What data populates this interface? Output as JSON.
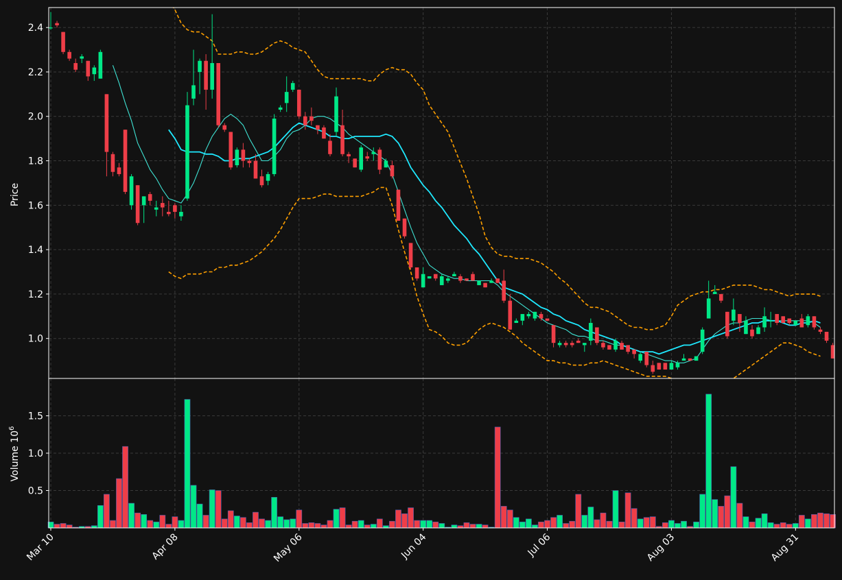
{
  "chart_data": {
    "type": "candlestick",
    "theme": {
      "background": "#121212",
      "grid": "#3a3a3a",
      "up": "#00e887",
      "down": "#ee3e48",
      "ma_fast": "#3fe3d4",
      "ma_slow": "#1fe9ff",
      "bands": "#ffa000",
      "axis": "#ffffff"
    },
    "price_panel": {
      "ylabel": "Price",
      "ylim": [
        0.82,
        2.49
      ],
      "yticks": [
        1.0,
        1.2,
        1.4,
        1.6,
        1.8,
        2.0,
        2.2,
        2.4
      ],
      "ytick_labels": [
        "1.0",
        "1.2",
        "1.4",
        "1.6",
        "1.8",
        "2.0",
        "2.2",
        "2.4"
      ]
    },
    "volume_panel": {
      "ylabel": "Volume",
      "ylabel_suffix": "10",
      "ylabel_exp": "6",
      "ylim": [
        0,
        2.0
      ],
      "yticks": [
        0.5,
        1.0,
        1.5
      ],
      "ytick_labels": [
        "0.5",
        "1.0",
        "1.5"
      ]
    },
    "x_ticks": [
      {
        "index": 0,
        "label": "Mar 10"
      },
      {
        "index": 20,
        "label": "Apr 08"
      },
      {
        "index": 40,
        "label": "May 06"
      },
      {
        "index": 60,
        "label": "Jun 04"
      },
      {
        "index": 80,
        "label": "Jul 06"
      },
      {
        "index": 100,
        "label": "Aug 03"
      },
      {
        "index": 120,
        "label": "Aug 31"
      }
    ],
    "candles": [
      [
        2.4,
        2.47,
        2.39,
        2.4,
        0.08
      ],
      [
        2.42,
        2.43,
        2.4,
        2.41,
        0.05
      ],
      [
        2.38,
        2.38,
        2.28,
        2.29,
        0.06
      ],
      [
        2.29,
        2.3,
        2.25,
        2.26,
        0.04
      ],
      [
        2.24,
        2.26,
        2.2,
        2.21,
        0.01
      ],
      [
        2.26,
        2.28,
        2.24,
        2.27,
        0.02
      ],
      [
        2.25,
        2.25,
        2.16,
        2.18,
        0.02
      ],
      [
        2.19,
        2.23,
        2.16,
        2.22,
        0.03
      ],
      [
        2.17,
        2.3,
        2.17,
        2.29,
        0.3
      ],
      [
        2.1,
        2.1,
        1.73,
        1.84,
        0.45
      ],
      [
        1.83,
        1.84,
        1.73,
        1.75,
        0.1
      ],
      [
        1.77,
        1.79,
        1.73,
        1.74,
        0.66
      ],
      [
        1.94,
        1.94,
        1.65,
        1.66,
        1.09
      ],
      [
        1.6,
        1.74,
        1.58,
        1.73,
        0.33
      ],
      [
        1.69,
        1.69,
        1.51,
        1.52,
        0.2
      ],
      [
        1.6,
        1.64,
        1.52,
        1.64,
        0.18
      ],
      [
        1.65,
        1.66,
        1.6,
        1.62,
        0.1
      ],
      [
        1.58,
        1.62,
        1.55,
        1.59,
        0.08
      ],
      [
        1.61,
        1.64,
        1.55,
        1.59,
        0.17
      ],
      [
        1.57,
        1.62,
        1.55,
        1.56,
        0.05
      ],
      [
        1.6,
        1.61,
        1.54,
        1.57,
        0.15
      ],
      [
        1.55,
        1.6,
        1.53,
        1.57,
        0.1
      ],
      [
        1.63,
        2.11,
        1.62,
        2.05,
        1.72
      ],
      [
        2.08,
        2.3,
        2.05,
        2.14,
        0.57
      ],
      [
        2.2,
        2.26,
        2.1,
        2.25,
        0.32
      ],
      [
        2.25,
        2.28,
        2.03,
        2.12,
        0.17
      ],
      [
        2.12,
        2.46,
        2.08,
        2.24,
        0.51
      ],
      [
        2.24,
        2.24,
        1.95,
        1.96,
        0.5
      ],
      [
        1.96,
        1.97,
        1.93,
        1.94,
        0.12
      ],
      [
        1.93,
        1.93,
        1.76,
        1.77,
        0.23
      ],
      [
        1.78,
        1.86,
        1.77,
        1.85,
        0.16
      ],
      [
        1.85,
        1.88,
        1.77,
        1.8,
        0.14
      ],
      [
        1.8,
        1.81,
        1.77,
        1.79,
        0.07
      ],
      [
        1.8,
        1.83,
        1.72,
        1.72,
        0.21
      ],
      [
        1.73,
        1.76,
        1.68,
        1.69,
        0.12
      ],
      [
        1.71,
        1.75,
        1.69,
        1.74,
        0.1
      ],
      [
        1.74,
        2.01,
        1.73,
        1.99,
        0.41
      ],
      [
        2.03,
        2.05,
        2.02,
        2.04,
        0.15
      ],
      [
        2.06,
        2.18,
        2.02,
        2.11,
        0.11
      ],
      [
        2.12,
        2.16,
        2.11,
        2.15,
        0.12
      ],
      [
        2.12,
        2.12,
        1.99,
        2.0,
        0.24
      ],
      [
        2.0,
        2.02,
        1.94,
        1.96,
        0.06
      ],
      [
        2.0,
        2.04,
        1.96,
        1.98,
        0.07
      ],
      [
        1.96,
        1.96,
        1.92,
        1.94,
        0.06
      ],
      [
        1.95,
        1.96,
        1.9,
        1.9,
        0.04
      ],
      [
        1.89,
        1.92,
        1.82,
        1.83,
        0.1
      ],
      [
        1.93,
        2.13,
        1.91,
        2.09,
        0.25
      ],
      [
        1.96,
        2.03,
        1.82,
        1.83,
        0.27
      ],
      [
        1.83,
        1.84,
        1.79,
        1.82,
        0.04
      ],
      [
        1.81,
        1.81,
        1.77,
        1.77,
        0.09
      ],
      [
        1.76,
        1.87,
        1.75,
        1.86,
        0.1
      ],
      [
        1.82,
        1.84,
        1.8,
        1.81,
        0.04
      ],
      [
        1.83,
        1.86,
        1.8,
        1.84,
        0.05
      ],
      [
        1.85,
        1.86,
        1.74,
        1.76,
        0.12
      ],
      [
        1.77,
        1.81,
        1.77,
        1.8,
        0.03
      ],
      [
        1.78,
        1.8,
        1.72,
        1.73,
        0.09
      ],
      [
        1.67,
        1.67,
        1.53,
        1.53,
        0.24
      ],
      [
        1.54,
        1.54,
        1.45,
        1.46,
        0.19
      ],
      [
        1.43,
        1.43,
        1.31,
        1.32,
        0.27
      ],
      [
        1.32,
        1.32,
        1.26,
        1.27,
        0.1
      ],
      [
        1.23,
        1.32,
        1.23,
        1.29,
        0.1
      ],
      [
        1.27,
        1.28,
        1.27,
        1.28,
        0.1
      ],
      [
        1.29,
        1.29,
        1.26,
        1.27,
        0.08
      ],
      [
        1.24,
        1.29,
        1.24,
        1.28,
        0.06
      ],
      [
        1.26,
        1.28,
        1.25,
        1.27,
        0.01
      ],
      [
        1.28,
        1.3,
        1.28,
        1.29,
        0.04
      ],
      [
        1.28,
        1.29,
        1.25,
        1.26,
        0.03
      ],
      [
        1.27,
        1.27,
        1.26,
        1.26,
        0.07
      ],
      [
        1.29,
        1.3,
        1.26,
        1.26,
        0.05
      ],
      [
        1.24,
        1.26,
        1.24,
        1.26,
        0.05
      ],
      [
        1.25,
        1.25,
        1.23,
        1.23,
        0.04
      ],
      [
        1.25,
        1.27,
        1.25,
        1.26,
        0.01
      ],
      [
        1.27,
        1.27,
        1.25,
        1.25,
        1.35
      ],
      [
        1.26,
        1.31,
        1.16,
        1.17,
        0.29
      ],
      [
        1.17,
        1.2,
        1.04,
        1.04,
        0.24
      ],
      [
        1.07,
        1.09,
        1.07,
        1.08,
        0.14
      ],
      [
        1.08,
        1.11,
        1.06,
        1.11,
        0.08
      ],
      [
        1.1,
        1.12,
        1.09,
        1.11,
        0.12
      ],
      [
        1.09,
        1.12,
        1.08,
        1.12,
        0.04
      ],
      [
        1.11,
        1.12,
        1.08,
        1.09,
        0.08
      ],
      [
        1.09,
        1.09,
        1.08,
        1.08,
        0.1
      ],
      [
        1.06,
        1.06,
        0.96,
        0.98,
        0.14
      ],
      [
        0.97,
        0.99,
        0.96,
        0.98,
        0.17
      ],
      [
        0.98,
        0.99,
        0.96,
        0.97,
        0.06
      ],
      [
        0.98,
        0.99,
        0.96,
        0.97,
        0.09
      ],
      [
        0.99,
        1.0,
        0.98,
        0.98,
        0.45
      ],
      [
        0.97,
        0.98,
        0.94,
        0.98,
        0.17
      ],
      [
        0.99,
        1.09,
        0.97,
        1.07,
        0.28
      ],
      [
        1.05,
        1.05,
        0.97,
        0.98,
        0.11
      ],
      [
        0.98,
        0.99,
        0.95,
        0.96,
        0.2
      ],
      [
        0.97,
        0.97,
        0.95,
        0.95,
        0.09
      ],
      [
        0.95,
        1.0,
        0.94,
        0.99,
        0.5
      ],
      [
        0.98,
        0.99,
        0.95,
        0.95,
        0.08
      ],
      [
        0.97,
        0.97,
        0.93,
        0.94,
        0.47
      ],
      [
        0.95,
        0.95,
        0.91,
        0.93,
        0.26
      ],
      [
        0.9,
        0.94,
        0.89,
        0.93,
        0.12
      ],
      [
        0.94,
        0.94,
        0.87,
        0.88,
        0.14
      ],
      [
        0.88,
        0.9,
        0.84,
        0.85,
        0.15
      ],
      [
        0.89,
        0.89,
        0.86,
        0.86,
        0.02
      ],
      [
        0.89,
        0.89,
        0.86,
        0.86,
        0.07
      ],
      [
        0.86,
        0.9,
        0.86,
        0.89,
        0.1
      ],
      [
        0.87,
        0.9,
        0.86,
        0.89,
        0.06
      ],
      [
        0.9,
        0.93,
        0.9,
        0.91,
        0.09
      ],
      [
        0.91,
        0.91,
        0.9,
        0.9,
        0.02
      ],
      [
        0.9,
        0.92,
        0.9,
        0.92,
        0.08
      ],
      [
        0.94,
        1.05,
        0.93,
        1.04,
        0.45
      ],
      [
        1.09,
        1.26,
        1.09,
        1.18,
        1.79
      ],
      [
        1.2,
        1.24,
        1.2,
        1.21,
        0.38
      ],
      [
        1.2,
        1.2,
        1.16,
        1.17,
        0.29
      ],
      [
        1.12,
        1.12,
        1.0,
        1.01,
        0.43
      ],
      [
        1.08,
        1.18,
        1.06,
        1.13,
        0.82
      ],
      [
        1.11,
        1.11,
        1.03,
        1.07,
        0.33
      ],
      [
        1.02,
        1.1,
        1.02,
        1.08,
        0.15
      ],
      [
        1.04,
        1.06,
        1.0,
        1.01,
        0.08
      ],
      [
        1.02,
        1.06,
        1.02,
        1.05,
        0.13
      ],
      [
        1.05,
        1.14,
        1.03,
        1.1,
        0.19
      ],
      [
        1.08,
        1.12,
        1.05,
        1.08,
        0.07
      ],
      [
        1.11,
        1.11,
        1.06,
        1.07,
        0.05
      ],
      [
        1.1,
        1.1,
        1.07,
        1.07,
        0.07
      ],
      [
        1.09,
        1.09,
        1.06,
        1.07,
        0.05
      ],
      [
        1.06,
        1.08,
        1.06,
        1.08,
        0.06
      ],
      [
        1.09,
        1.11,
        1.05,
        1.05,
        0.17
      ],
      [
        1.06,
        1.11,
        1.05,
        1.1,
        0.12
      ],
      [
        1.1,
        1.1,
        1.04,
        1.05,
        0.18
      ],
      [
        1.04,
        1.05,
        1.02,
        1.03,
        0.2
      ],
      [
        1.03,
        1.03,
        0.98,
        0.99,
        0.19
      ],
      [
        0.97,
        0.98,
        0.91,
        0.91,
        0.18
      ]
    ],
    "ma_fast": [
      null,
      null,
      null,
      null,
      null,
      null,
      null,
      null,
      null,
      null,
      2.23,
      2.15,
      2.06,
      1.98,
      1.88,
      1.82,
      1.76,
      1.72,
      1.67,
      1.63,
      1.62,
      1.61,
      1.65,
      1.7,
      1.77,
      1.85,
      1.91,
      1.95,
      1.99,
      2.01,
      1.99,
      1.96,
      1.9,
      1.85,
      1.8,
      1.8,
      1.82,
      1.85,
      1.9,
      1.93,
      1.94,
      1.96,
      1.99,
      2.0,
      2.0,
      1.99,
      1.97,
      1.95,
      1.92,
      1.9,
      1.88,
      1.86,
      1.84,
      1.82,
      1.8,
      1.74,
      1.66,
      1.58,
      1.5,
      1.43,
      1.38,
      1.33,
      1.31,
      1.29,
      1.28,
      1.27,
      1.27,
      1.26,
      1.26,
      1.26,
      1.26,
      1.26,
      1.24,
      1.21,
      1.19,
      1.17,
      1.15,
      1.13,
      1.11,
      1.09,
      1.07,
      1.06,
      1.05,
      1.04,
      1.02,
      1.01,
      1.01,
      1.0,
      0.99,
      0.99,
      0.98,
      0.97,
      0.97,
      0.96,
      0.95,
      0.94,
      0.93,
      0.92,
      0.91,
      0.9,
      0.9,
      0.89,
      0.89,
      0.9,
      0.91,
      0.95,
      0.99,
      1.02,
      1.04,
      1.06,
      1.07,
      1.07,
      1.08,
      1.09,
      1.09,
      1.09,
      1.08,
      1.08,
      1.08,
      1.08,
      1.08,
      1.08,
      1.08,
      1.07,
      1.05
    ],
    "ma_slow": [
      null,
      null,
      null,
      null,
      null,
      null,
      null,
      null,
      null,
      null,
      null,
      null,
      null,
      null,
      null,
      null,
      null,
      null,
      null,
      1.94,
      1.9,
      1.85,
      1.84,
      1.84,
      1.84,
      1.83,
      1.83,
      1.82,
      1.8,
      1.8,
      1.81,
      1.81,
      1.81,
      1.82,
      1.83,
      1.84,
      1.86,
      1.89,
      1.92,
      1.95,
      1.97,
      1.96,
      1.95,
      1.94,
      1.93,
      1.91,
      1.91,
      1.9,
      1.9,
      1.91,
      1.91,
      1.91,
      1.91,
      1.91,
      1.92,
      1.91,
      1.88,
      1.83,
      1.77,
      1.73,
      1.69,
      1.66,
      1.62,
      1.59,
      1.55,
      1.51,
      1.48,
      1.45,
      1.41,
      1.38,
      1.34,
      1.3,
      1.26,
      1.23,
      1.22,
      1.21,
      1.2,
      1.18,
      1.16,
      1.14,
      1.13,
      1.11,
      1.1,
      1.08,
      1.07,
      1.06,
      1.04,
      1.03,
      1.02,
      1.01,
      1.0,
      0.99,
      0.97,
      0.96,
      0.95,
      0.94,
      0.94,
      0.94,
      0.93,
      0.94,
      0.95,
      0.96,
      0.97,
      0.97,
      0.98,
      0.99,
      1.0,
      1.01,
      1.02,
      1.03,
      1.04,
      1.05,
      1.06,
      1.07,
      1.07,
      1.08,
      1.08,
      1.08,
      1.07,
      1.06,
      1.06,
      1.07,
      1.07,
      1.08,
      1.07
    ],
    "band_upper": [
      null,
      null,
      null,
      null,
      null,
      null,
      null,
      null,
      null,
      null,
      null,
      null,
      null,
      null,
      null,
      null,
      null,
      null,
      null,
      2.52,
      2.48,
      2.42,
      2.39,
      2.38,
      2.38,
      2.36,
      2.34,
      2.28,
      2.28,
      2.28,
      2.29,
      2.29,
      2.28,
      2.28,
      2.29,
      2.31,
      2.33,
      2.34,
      2.33,
      2.31,
      2.3,
      2.29,
      2.25,
      2.21,
      2.18,
      2.17,
      2.17,
      2.17,
      2.17,
      2.17,
      2.17,
      2.16,
      2.16,
      2.19,
      2.21,
      2.22,
      2.21,
      2.21,
      2.19,
      2.15,
      2.12,
      2.05,
      2.01,
      1.97,
      1.93,
      1.86,
      1.79,
      1.72,
      1.64,
      1.56,
      1.46,
      1.41,
      1.38,
      1.37,
      1.37,
      1.36,
      1.36,
      1.36,
      1.35,
      1.34,
      1.32,
      1.3,
      1.27,
      1.25,
      1.22,
      1.19,
      1.16,
      1.14,
      1.14,
      1.13,
      1.12,
      1.1,
      1.08,
      1.06,
      1.05,
      1.05,
      1.04,
      1.04,
      1.05,
      1.06,
      1.1,
      1.15,
      1.17,
      1.19,
      1.2,
      1.21,
      1.21,
      1.22,
      1.22,
      1.23,
      1.24,
      1.24,
      1.24,
      1.24,
      1.23,
      1.22,
      1.22,
      1.21,
      1.2,
      1.19,
      1.2,
      1.2,
      1.2,
      1.2,
      1.19
    ],
    "band_lower": [
      null,
      null,
      null,
      null,
      null,
      null,
      null,
      null,
      null,
      null,
      null,
      null,
      null,
      null,
      null,
      null,
      null,
      null,
      null,
      1.3,
      1.28,
      1.27,
      1.29,
      1.29,
      1.29,
      1.3,
      1.3,
      1.32,
      1.32,
      1.33,
      1.33,
      1.34,
      1.35,
      1.37,
      1.39,
      1.42,
      1.45,
      1.49,
      1.54,
      1.59,
      1.63,
      1.63,
      1.63,
      1.64,
      1.65,
      1.65,
      1.64,
      1.64,
      1.64,
      1.64,
      1.64,
      1.65,
      1.66,
      1.68,
      1.68,
      1.6,
      1.49,
      1.39,
      1.3,
      1.19,
      1.11,
      1.04,
      1.03,
      1.01,
      0.98,
      0.97,
      0.97,
      0.98,
      1.01,
      1.04,
      1.06,
      1.07,
      1.06,
      1.05,
      1.03,
      1.01,
      0.98,
      0.96,
      0.94,
      0.92,
      0.9,
      0.9,
      0.89,
      0.89,
      0.88,
      0.88,
      0.88,
      0.89,
      0.89,
      0.9,
      0.89,
      0.88,
      0.87,
      0.86,
      0.85,
      0.84,
      0.83,
      0.83,
      0.83,
      0.83,
      0.82,
      0.81,
      0.8,
      0.79,
      0.78,
      0.77,
      0.77,
      0.77,
      0.79,
      0.81,
      0.82,
      0.84,
      0.86,
      0.88,
      0.9,
      0.92,
      0.94,
      0.96,
      0.98,
      0.98,
      0.97,
      0.96,
      0.94,
      0.93,
      0.92
    ]
  }
}
